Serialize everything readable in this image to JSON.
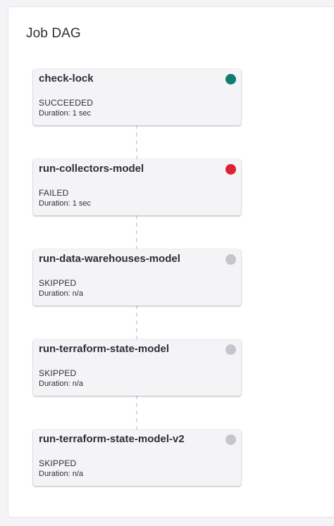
{
  "panel": {
    "title": "Job DAG"
  },
  "colors": {
    "succeeded": "#0f7d6e",
    "failed": "#e02035",
    "skipped": "#c4c6cc"
  },
  "jobs": [
    {
      "name": "check-lock",
      "status": "SUCCEEDED",
      "duration": "Duration: 1 sec",
      "state": "succeeded"
    },
    {
      "name": "run-collectors-model",
      "status": "FAILED",
      "duration": "Duration: 1 sec",
      "state": "failed"
    },
    {
      "name": "run-data-warehouses-model",
      "status": "SKIPPED",
      "duration": "Duration: n/a",
      "state": "skipped"
    },
    {
      "name": "run-terraform-state-model",
      "status": "SKIPPED",
      "duration": "Duration: n/a",
      "state": "skipped"
    },
    {
      "name": "run-terraform-state-model-v2",
      "status": "SKIPPED",
      "duration": "Duration: n/a",
      "state": "skipped"
    }
  ]
}
